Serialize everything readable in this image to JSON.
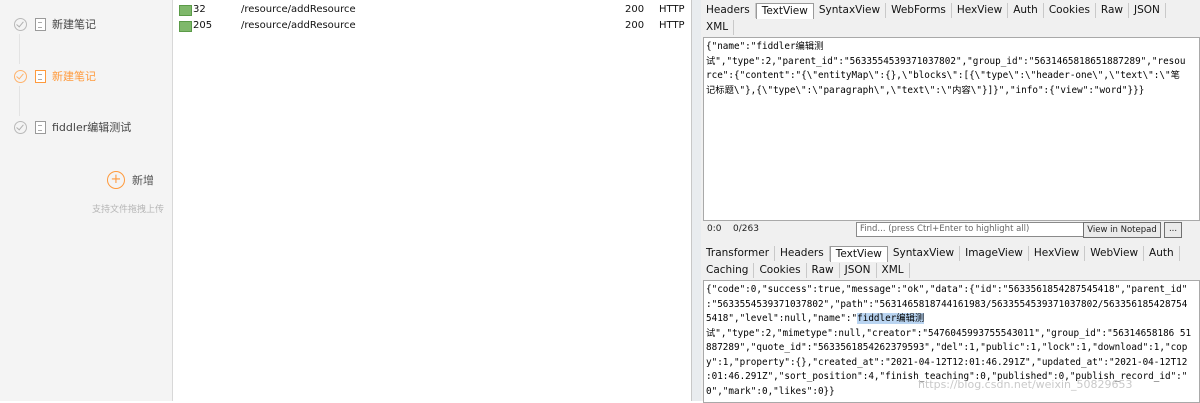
{
  "notes": {
    "items": [
      {
        "label": "新建笔记",
        "active": false
      },
      {
        "label": "新建笔记",
        "active": true
      },
      {
        "label": "fiddler编辑测试",
        "active": false
      }
    ],
    "add_label": "新增",
    "drag_hint": "支持文件拖拽上传",
    "accent_color": "#ff9a3c"
  },
  "sessions": [
    {
      "id": "32",
      "url": "/resource/addResource",
      "status": "200",
      "protocol": "HTTP"
    },
    {
      "id": "205",
      "url": "/resource/addResource",
      "status": "200",
      "protocol": "HTTP"
    }
  ],
  "request": {
    "tabs_row1": [
      "Headers",
      "TextView",
      "SyntaxView",
      "WebForms",
      "HexView",
      "Auth",
      "Cookies",
      "Raw",
      "JSON"
    ],
    "tabs_row2": [
      "XML"
    ],
    "selected_tab": "TextView",
    "body_lines": [
      "{\"name\":\"fiddler编辑测",
      "试\",\"type\":2,\"parent_id\":\"5633554539371037802\",\"group_id\":\"5631465818651887289\",\"resou",
      "rce\":{\"content\":\"{\\\"entityMap\\\":{},\\\"blocks\\\":[{\\\"type\\\":\\\"header-one\\\",\\\"text\\\":\\\"笔",
      "记标题\\\"},{\\\"type\\\":\\\"paragraph\\\",\\\"text\\\":\\\"内容\\\"}]}\",\"info\":{\"view\":\"word\"}}}"
    ],
    "cursor_pos": "0:0",
    "char_count": "0/263",
    "find_placeholder": "Find... (press Ctrl+Enter to highlight all)",
    "view_notepad": "View in Notepad",
    "more_button": "..."
  },
  "response": {
    "tabs_row1": [
      "Transformer",
      "Headers",
      "TextView",
      "SyntaxView",
      "ImageView",
      "HexView",
      "WebView",
      "Auth"
    ],
    "tabs_row2": [
      "Caching",
      "Cookies",
      "Raw",
      "JSON",
      "XML"
    ],
    "selected_tab": "TextView",
    "body_lines": [
      "{\"code\":0,\"success\":true,\"message\":\"ok\",\"data\":{\"id\":\"5633561854287545418\",\"parent_id\"",
      ":\"5633554539371037802\",\"path\":\"5631465818744161983/5633554539371037802/563356185428754",
      "5418\",\"level\":null,\"name\":\"",
      "试\",\"type\":2,\"mimetype\":null,\"creator\":\"5476045993755543011\",\"group_id\":\"56314658186 51",
      "887289\",\"quote_id\":\"5633561854262379593\",\"del\":1,\"public\":1,\"lock\":1,\"download\":1,\"cop",
      "y\":1,\"property\":{},\"created_at\":\"2021-04-12T12:01:46.291Z\",\"updated_at\":\"2021-04-12T12",
      ":01:46.291Z\",\"sort_position\":4,\"finish_teaching\":0,\"published\":0,\"publish_record_id\":\"",
      "0\",\"mark\":0,\"likes\":0}}"
    ],
    "highlight": "fiddler编辑测"
  },
  "watermark": "https://blog.csdn.net/weixin_50829653"
}
